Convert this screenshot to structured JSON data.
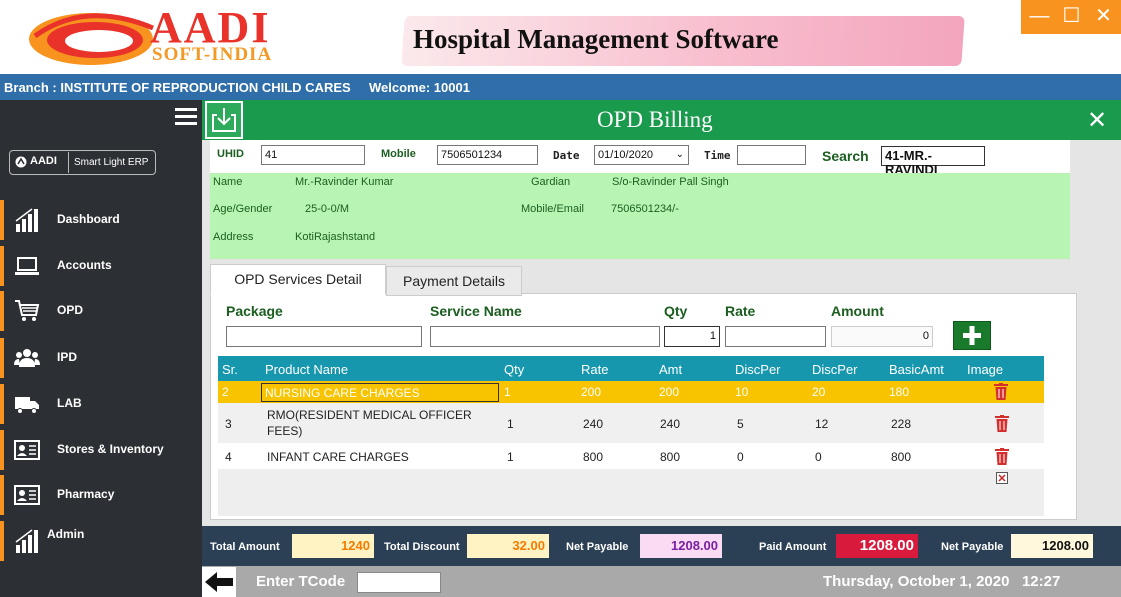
{
  "logo": {
    "brand": "AADI",
    "sub": "SOFT-INDIA"
  },
  "banner_title": "Hospital Management Software",
  "window_controls": {
    "minimize": "—",
    "maximize": "☐",
    "close": "✕"
  },
  "branch_bar": {
    "branch": "Branch : INSTITUTE OF REPRODUCTION  CHILD CARES",
    "welcome": "Welcome: 10001"
  },
  "sidebar": {
    "badge_brand": "AADI",
    "badge_text": "Smart Light ERP",
    "items": [
      {
        "label": "Dashboard",
        "icon": "bar-chart-icon"
      },
      {
        "label": "Accounts",
        "icon": "laptop-icon"
      },
      {
        "label": "OPD",
        "icon": "cart-icon"
      },
      {
        "label": "IPD",
        "icon": "users-icon"
      },
      {
        "label": "LAB",
        "icon": "truck-icon"
      },
      {
        "label": "Stores & Inventory",
        "icon": "id-card-icon"
      },
      {
        "label": "Pharmacy",
        "icon": "id-card-icon"
      },
      {
        "label": "Admin",
        "icon": "bar-chart-icon"
      }
    ]
  },
  "main": {
    "title": "OPD Billing",
    "uhid_label": "UHID",
    "uhid": "41",
    "mobile_label": "Mobile",
    "mobile": "7506501234",
    "date_label": "Date",
    "date": "01/10/2020",
    "time_label": "Time",
    "time": "",
    "search_label": "Search",
    "search": "41-MR.-RAVINDI"
  },
  "patient": {
    "name_label": "Name",
    "name": "Mr.-Ravinder Kumar",
    "gardian_label": "Gardian",
    "gardian": "S/o-Ravinder Pall Singh",
    "age_label": "Age/Gender",
    "age": "25-0-0/M",
    "mobile_email_label": "Mobile/Email",
    "mobile_email": "7506501234/-",
    "address_label": "Address",
    "address": "KotiRajashstand"
  },
  "tabs": {
    "services": "OPD Services Detail",
    "payment": "Payment Details"
  },
  "entry": {
    "package_label": "Package",
    "service_label": "Service Name",
    "qty_label": "Qty",
    "rate_label": "Rate",
    "amount_label": "Amount",
    "qty": "1",
    "amount": "0"
  },
  "grid": {
    "headers": [
      "Sr.",
      "Product Name",
      "Qty",
      "Rate",
      "Amt",
      "DiscPer",
      "DiscPer",
      "BasicAmt",
      "Image"
    ],
    "rows": [
      {
        "sr": "2",
        "name": "NURSING CARE CHARGES",
        "qty": "1",
        "rate": "200",
        "amt": "200",
        "disc1": "10",
        "disc2": "20",
        "basic": "180"
      },
      {
        "sr": "3",
        "name": "RMO(RESIDENT MEDICAL OFFICER FEES)",
        "qty": "1",
        "rate": "240",
        "amt": "240",
        "disc1": "5",
        "disc2": "12",
        "basic": "228"
      },
      {
        "sr": "4",
        "name": "INFANT CARE CHARGES",
        "qty": "1",
        "rate": "800",
        "amt": "800",
        "disc1": "0",
        "disc2": "0",
        "basic": "800"
      }
    ]
  },
  "totals": {
    "total_amount_label": "Total Amount",
    "total_amount": "1240",
    "total_discount_label": "Total Discount",
    "total_discount": "32.00",
    "net_payable_label": "Net Payable",
    "net_payable": "1208.00",
    "paid_amount_label": "Paid Amount",
    "paid_amount": "1208.00",
    "net_payable2_label": "Net Payable",
    "net_payable2": "1208.00"
  },
  "bottom": {
    "tcode_label": "Enter TCode",
    "datetime": "Thursday, October 1, 2020   12:27"
  },
  "colors": {
    "accent_green": "#1a9a4c",
    "sidebar_bg": "#2c2f33",
    "selected_row": "#f8c400",
    "grid_head": "#1797ad",
    "nav_accent": "#f7931e"
  }
}
